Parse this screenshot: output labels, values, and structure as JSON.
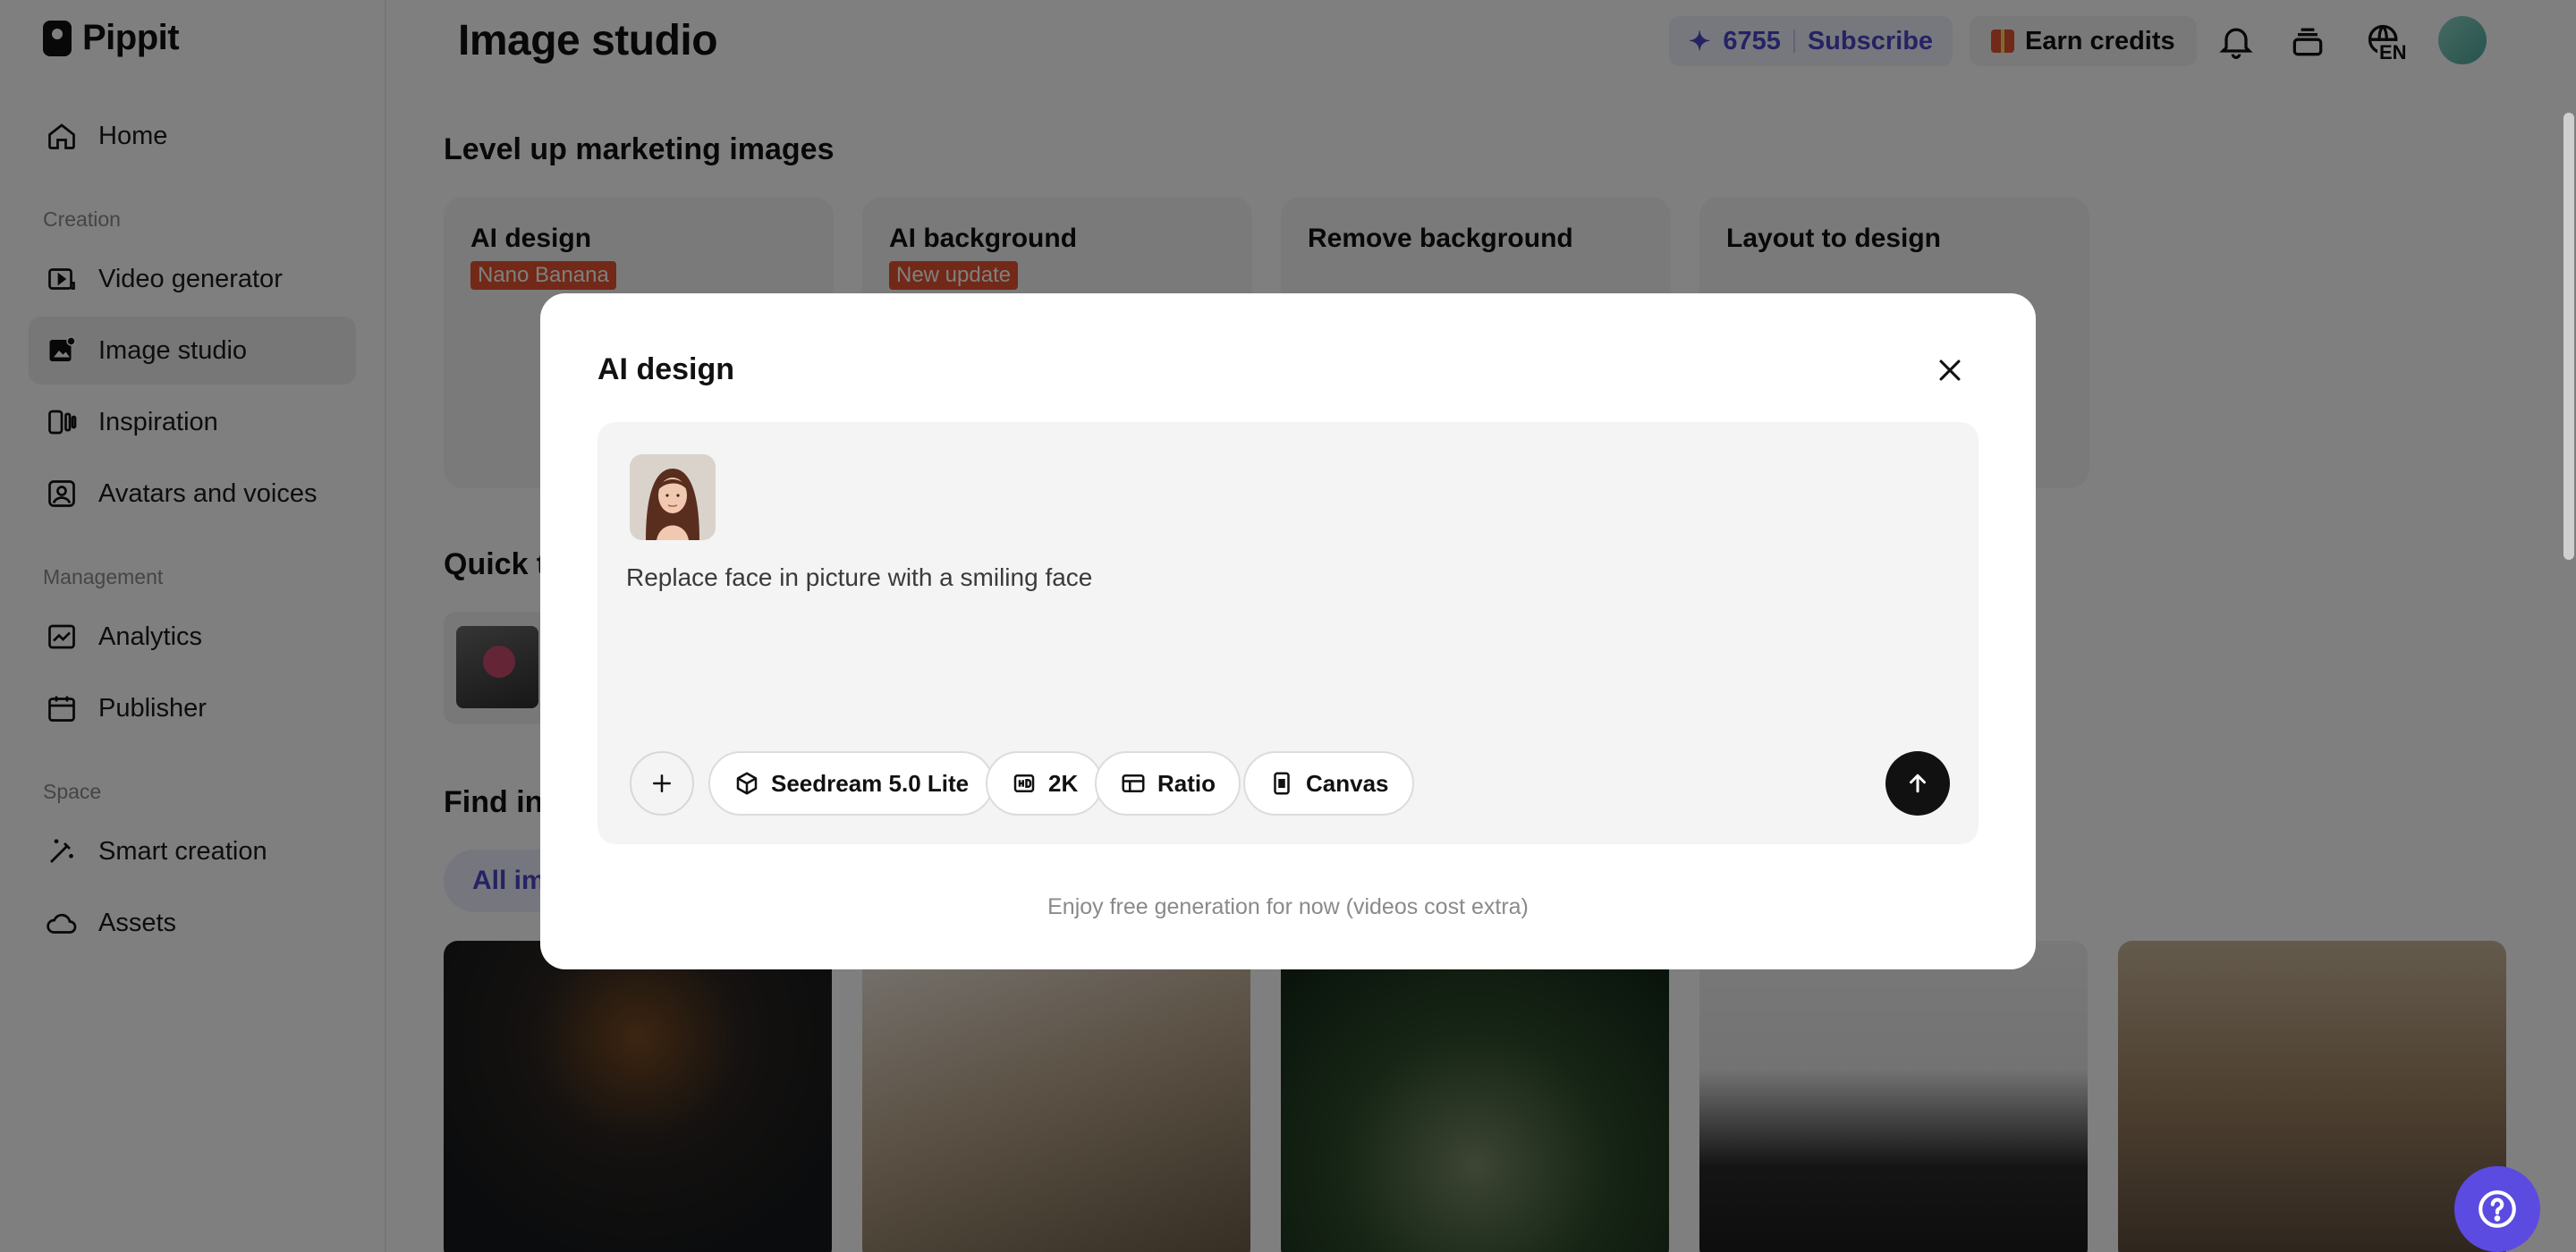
{
  "app": {
    "brand": "Pippit"
  },
  "sidebar": {
    "home": "Home",
    "sections": {
      "creation": "Creation",
      "management": "Management",
      "space": "Space"
    },
    "items": {
      "video_generator": "Video generator",
      "image_studio": "Image studio",
      "inspiration": "Inspiration",
      "avatars_voices": "Avatars and voices",
      "analytics": "Analytics",
      "publisher": "Publisher",
      "smart_creation": "Smart creation",
      "assets": "Assets"
    },
    "active_item": "Image studio"
  },
  "header": {
    "title": "Image studio",
    "credits": "6755",
    "subscribe": "Subscribe",
    "earn_credits": "Earn credits",
    "language": "EN"
  },
  "main": {
    "level_up_heading": "Level up marketing images",
    "cards": [
      {
        "title": "AI design",
        "badge": "Nano Banana"
      },
      {
        "title": "AI background",
        "badge": "New update"
      },
      {
        "title": "Remove background",
        "badge": ""
      },
      {
        "title": "Layout to design",
        "badge": ""
      }
    ],
    "quick_heading": "Quick t",
    "find_heading": "Find ins",
    "filter_chip": "All ima"
  },
  "modal": {
    "title": "AI design",
    "prompt": "Replace face in picture with a smiling face",
    "options": {
      "model": "Seedream 5.0 Lite",
      "resolution": "2K",
      "ratio": "Ratio",
      "canvas": "Canvas"
    },
    "footnote": "Enjoy free generation for now (videos cost extra)"
  },
  "colors": {
    "accent": "#4a47c7",
    "badge": "#e4532f",
    "help_button": "#5b4be0",
    "send_button": "#111111"
  }
}
